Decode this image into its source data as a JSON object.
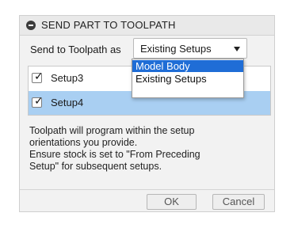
{
  "dialog": {
    "title": "SEND PART TO TOOLPATH",
    "send_label": "Send to Toolpath as",
    "select_value": "Existing Setups",
    "dropdown_options": [
      "Model Body",
      "Existing Setups"
    ],
    "dropdown_selected": "Model Body",
    "setups": [
      {
        "label": "Setup3",
        "checked": true,
        "selected": false
      },
      {
        "label": "Setup4",
        "checked": true,
        "selected": true
      }
    ],
    "info_lines": [
      "Toolpath will program within the setup",
      "orientations you provide.",
      "Ensure stock is set to \"From Preceding",
      "Setup\" for subsequent setups."
    ],
    "buttons": {
      "ok": "OK",
      "cancel": "Cancel"
    }
  },
  "colors": {
    "selection_row": "#a9cff2",
    "dropdown_highlight": "#1f6dd6"
  }
}
